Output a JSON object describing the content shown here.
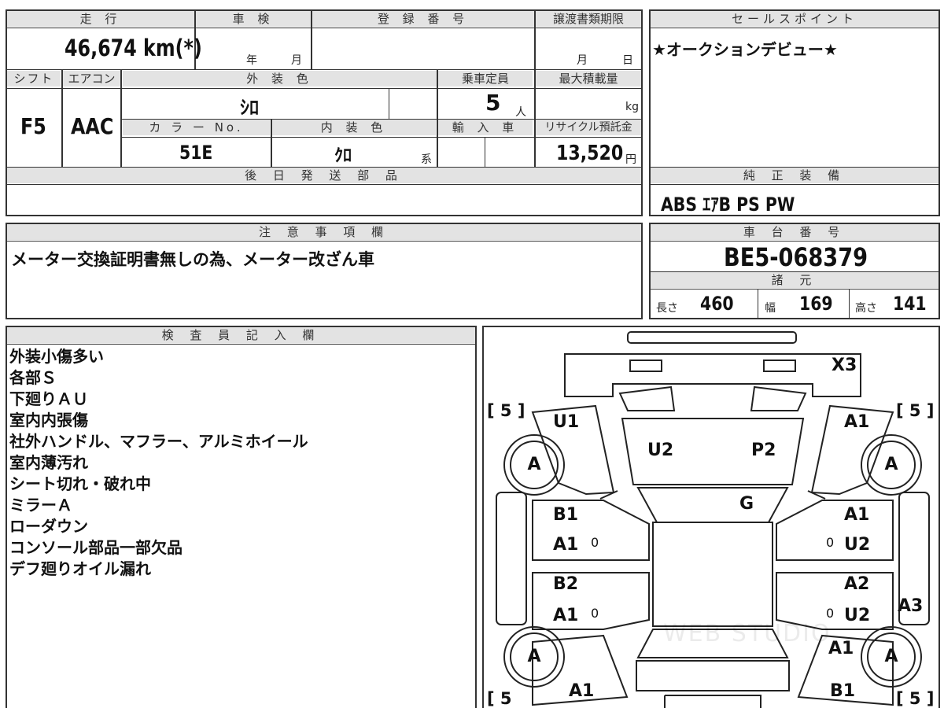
{
  "top_sheet": {
    "headers": {
      "mileage": "走 行",
      "inspection": "車 検",
      "registration": "登 録 番 号",
      "transfer": "譲渡書類期限",
      "sales_point": "セールスポイント",
      "shift": "シフト",
      "aircon": "エアコン",
      "exterior_color": "外 装 色",
      "capacity": "乗車定員",
      "max_load": "最大積載量",
      "color_no": "カ ラ ー No.",
      "interior_color": "内 装 色",
      "import": "輸 入 車",
      "recycle": "リサイクル預託金",
      "later_parts": "後 日 発 送 部 品",
      "equipment": "純 正 装 備"
    },
    "mileage": "46,674 km(*)",
    "inspection_year_unit": "年",
    "inspection_month_unit": "月",
    "transfer_month_unit": "月",
    "transfer_day_unit": "日",
    "sales_point": "★オークションデビュー★",
    "shift": "F5",
    "aircon": "AAC",
    "exterior_color": "ｼﾛ",
    "capacity": "5",
    "capacity_unit": "人",
    "max_load_unit": "kg",
    "color_no": "51E",
    "interior_color": "ｸﾛ",
    "interior_color_suffix": "系",
    "recycle": "13,520",
    "recycle_unit": "円",
    "equipment": "ABS ｴｱB PS PW"
  },
  "notes_section": {
    "header": "注 意 事 項 欄",
    "text": "メーター交換証明書無しの為、メーター改ざん車"
  },
  "chassis_section": {
    "header": "車 台 番 号",
    "number": "BE5-068379",
    "spec_header": "諸 元",
    "length_label": "長さ",
    "length": "460",
    "width_label": "幅",
    "width": "169",
    "height_label": "高さ",
    "height": "141"
  },
  "inspector": {
    "header": "検 査 員 記 入 欄",
    "lines": [
      "外装小傷多い",
      "各部Ｓ",
      "下廻りＡＵ",
      "室内内張傷",
      "社外ハンドル、マフラー、アルミホイール",
      "室内薄汚れ",
      "シート切れ・破れ中",
      "ミラーＡ",
      "ローダウン",
      "コンソール部品一部欠品",
      "デフ廻りオイル漏れ"
    ]
  },
  "diagram": {
    "tread_tl": "[ 5 ]",
    "tread_tr": "[ 5 ]",
    "tread_bl": "[ 5",
    "tread_br": "[ 5 ]",
    "tire_fl": "A",
    "tire_fr": "A",
    "tire_rl": "A",
    "tire_rr": "A",
    "marks": {
      "bumper_front": "X3",
      "left_front_fender": "U1",
      "hood_left": "U2",
      "hood_right": "P2",
      "right_front_fender": "A1",
      "windshield": "G",
      "left_front_door_a": "B1",
      "left_front_door_b": "A1",
      "left_front_door_0": "0",
      "left_rear_door_a": "B2",
      "left_rear_door_b": "A1",
      "left_rear_door_0": "0",
      "right_front_door_a": "A1",
      "right_front_door_0": "0",
      "right_front_door_b": "U2",
      "right_rear_door_a": "A2",
      "right_rear_door_0": "0",
      "right_rear_door_b": "U2",
      "right_side_sill": "A3",
      "right_quarter": "A1",
      "left_rear_bottom": "A1",
      "right_rear_bottom": "B1"
    },
    "watermark": "WEB STUDIO"
  }
}
